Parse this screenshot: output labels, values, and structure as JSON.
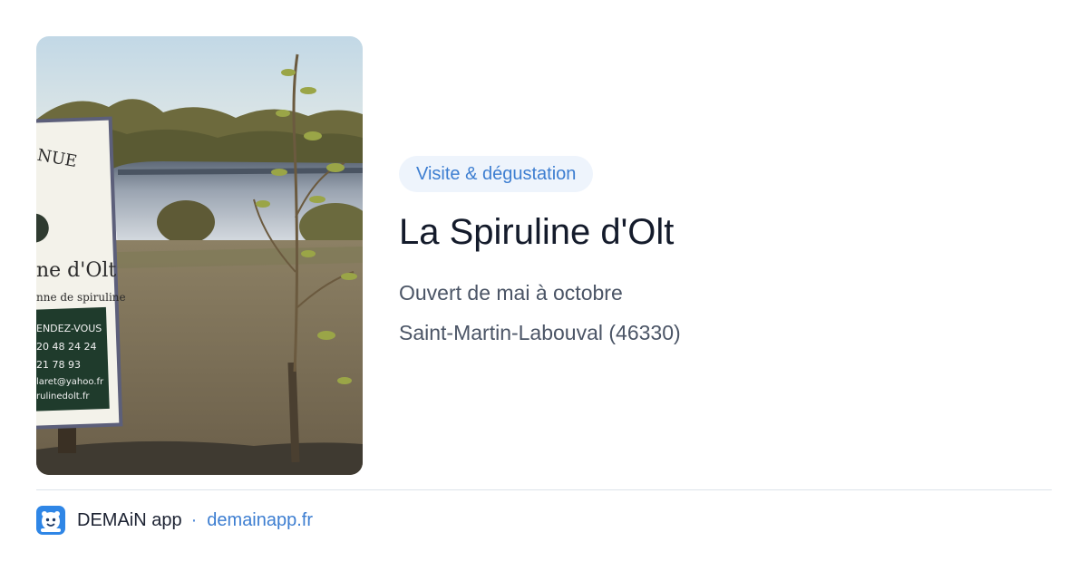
{
  "card": {
    "category": "Visite & dégustation",
    "title": "La Spiruline d'Olt",
    "hours": "Ouvert de mai à octobre",
    "location": "Saint-Martin-Labouval (46330)"
  },
  "photo": {
    "sign_lines": [
      "NUE",
      "ne d'Olt",
      "nne de spiruline",
      "ENDEZ-VOUS",
      "20 48 24 24",
      "21 78 93",
      "laret@yahoo.fr",
      "rulinedolt.fr"
    ]
  },
  "footer": {
    "app_name": "DEMAiN app",
    "separator": "·",
    "site": "demainapp.fr"
  },
  "colors": {
    "accent": "#3d7ed1",
    "tag_background": "#eef4fc",
    "title": "#141b2b",
    "body_text": "#4b5566",
    "app_icon": "#2f86e6"
  }
}
